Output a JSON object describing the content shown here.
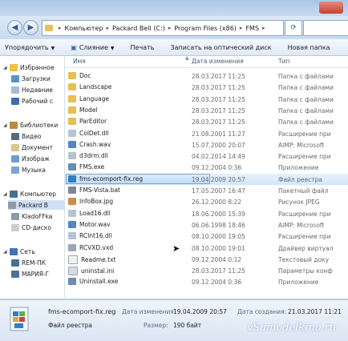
{
  "address": {
    "crumbs": [
      "Компьютер",
      "Packard Bell (C:)",
      "Program Files (x86)",
      "FMS"
    ]
  },
  "toolbar": {
    "organize": "Упорядочить",
    "merge": "Слияние",
    "print": "Печать",
    "burn": "Записать на оптический диск",
    "new_folder": "Новая папка"
  },
  "nav": {
    "favorites": "Избранное",
    "downloads": "Загрузки",
    "recent": "Недавние",
    "desktop": "Рабочий с",
    "libraries": "Библиотеки",
    "video": "Видео",
    "documents": "Документ",
    "images": "Изображ",
    "music": "Музыка",
    "computer": "Компьютер",
    "packard": "Packard B",
    "kladoff": "KladoFFka",
    "cd": "CD-диско",
    "network": "Сеть",
    "rem": "REM-ПК",
    "maria": "МАРИЯ-Г"
  },
  "columns": {
    "name": "Имя",
    "date": "Дата изменения",
    "type": "Тип"
  },
  "files": [
    {
      "name": "Doc",
      "date": "28.03.2017 11:25",
      "type": "Папка с файлами",
      "icon": "folder"
    },
    {
      "name": "Landscape",
      "date": "28.03.2017 11:25",
      "type": "Папка с файлами",
      "icon": "folder"
    },
    {
      "name": "Language",
      "date": "28.03.2017 11:25",
      "type": "Папка с файлами",
      "icon": "folder"
    },
    {
      "name": "Model",
      "date": "28.03.2017 11:25",
      "type": "Папка с файлами",
      "icon": "folder"
    },
    {
      "name": "ParEditor",
      "date": "28.03.2017 11:25",
      "type": "Папка с файлами",
      "icon": "folder"
    },
    {
      "name": "ColDet.dll",
      "date": "21.08.2001 11:27",
      "type": "Расширение при",
      "icon": "dll"
    },
    {
      "name": "Crash.wav",
      "date": "15.07.2000 20:07",
      "type": "AIMP: Microsoft",
      "icon": "wav"
    },
    {
      "name": "d3drm.dll",
      "date": "04.02.2014 14:49",
      "type": "Расширение при",
      "icon": "dll"
    },
    {
      "name": "FMS.exe",
      "date": "09.12.2004 0:36",
      "type": "Приложение",
      "icon": "exe"
    },
    {
      "name": "fms-ecomport-fix.reg",
      "date": "19.04.2009 20:57",
      "type": "Файл реестра",
      "icon": "reg"
    },
    {
      "name": "FMS-Vista.bat",
      "date": "17.05.2007 16:47",
      "type": "Пакетный файл",
      "icon": "bat"
    },
    {
      "name": "InfoBox.jpg",
      "date": "26.12.2000 8:22",
      "type": "Рисунок JPEG",
      "icon": "jpg"
    },
    {
      "name": "Load16.dll",
      "date": "18.06.2000 15:39",
      "type": "Расширение при",
      "icon": "dll"
    },
    {
      "name": "Motor.wav",
      "date": "06.06.1998 18:46",
      "type": "AIMP: Microsoft",
      "icon": "wav"
    },
    {
      "name": "RCInt16.dll",
      "date": "08.10.2000 19:05",
      "type": "Расширение при",
      "icon": "dll"
    },
    {
      "name": "RCVXD.vxd",
      "date": "08.10.2000 19:01",
      "type": "Драйвер виртуал",
      "icon": "vxd"
    },
    {
      "name": "Readme.txt",
      "date": "09.12.2004 0:12",
      "type": "Текстовый доку",
      "icon": "txt"
    },
    {
      "name": "uninstal.ini",
      "date": "28.03.2017 11:25",
      "type": "Параметры конф",
      "icon": "ini"
    },
    {
      "name": "Uninstall.exe",
      "date": "09.12.2004 0:36",
      "type": "Приложение",
      "icon": "exe"
    }
  ],
  "details": {
    "filename": "fms-ecomport-fix.reg",
    "filetype": "Файл реестра",
    "modified_label": "Дата изменения:",
    "modified_value": "19.04.2009 20:57",
    "size_label": "Размер:",
    "size_value": "190 байт",
    "created_label": "Дата создания:",
    "created_value": "21.03.2017 11:21"
  },
  "watermark": "vSamodelkino.ru",
  "colors": {
    "folder": "#e6bf55",
    "selection": "#cde3fa",
    "accent": "#3a6ea8"
  }
}
